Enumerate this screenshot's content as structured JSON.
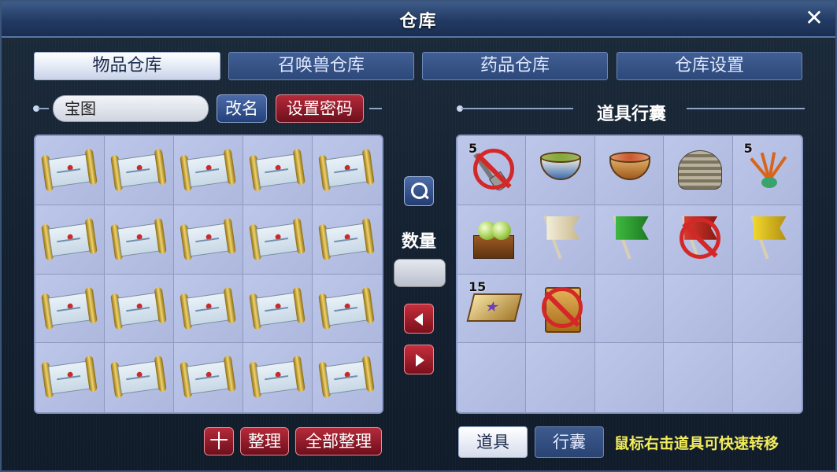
{
  "window": {
    "title": "仓库",
    "close_glyph": "✕"
  },
  "tabs": [
    {
      "label": "物品仓库",
      "active": true
    },
    {
      "label": "召唤兽仓库",
      "active": false
    },
    {
      "label": "药品仓库",
      "active": false
    },
    {
      "label": "仓库设置",
      "active": false
    }
  ],
  "warehouse": {
    "name_value": "宝图",
    "rename_label": "改名",
    "set_password_label": "设置密码",
    "item_icon": "treasure-map-scroll-icon",
    "slots_filled": 20
  },
  "middle": {
    "search_icon": "search-icon",
    "quantity_label": "数量",
    "quantity_value": ""
  },
  "bag": {
    "title": "道具行囊",
    "items": [
      {
        "icon": "shovel-icon",
        "qty": "5",
        "locked": true
      },
      {
        "icon": "bean-soup-bowl-icon",
        "qty": "",
        "locked": false
      },
      {
        "icon": "red-soup-bowl-icon",
        "qty": "",
        "locked": false
      },
      {
        "icon": "spiral-shell-icon",
        "qty": "",
        "locked": false
      },
      {
        "icon": "ginseng-plant-icon",
        "qty": "5",
        "locked": false
      },
      {
        "icon": "fruit-crate-icon",
        "qty": "",
        "locked": false
      },
      {
        "icon": "white-flag-icon",
        "qty": "",
        "locked": false
      },
      {
        "icon": "green-flag-icon",
        "qty": "",
        "locked": false
      },
      {
        "icon": "red-flag-icon",
        "qty": "",
        "locked": true
      },
      {
        "icon": "yellow-flag-icon",
        "qty": "",
        "locked": false
      },
      {
        "icon": "star-board-icon",
        "qty": "15",
        "locked": false
      },
      {
        "icon": "book-icon",
        "qty": "",
        "locked": true
      }
    ]
  },
  "footer": {
    "add_label": "十",
    "sort_label": "整理",
    "sort_all_label": "全部整理",
    "tab_items": "道具",
    "tab_bag": "行囊",
    "hint": "鼠标右击道具可快速转移"
  },
  "colors": {
    "accent": "#b52a3a",
    "hint": "#f2ec5a",
    "grid_bg": "#b5bfe2"
  }
}
